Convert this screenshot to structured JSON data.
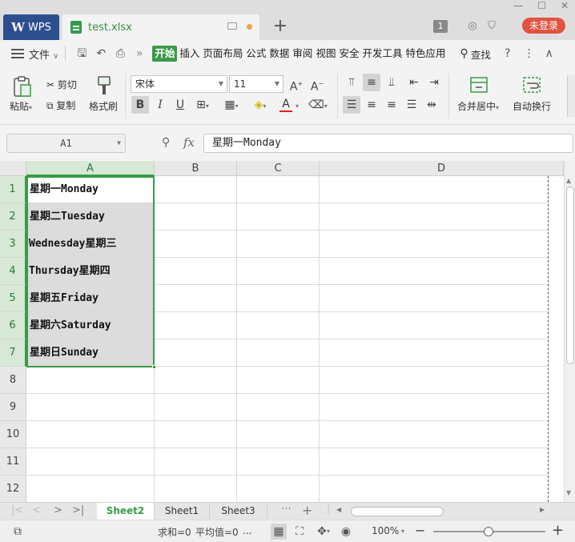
{
  "titlebar": {
    "app_tab": "WPS",
    "doc_tab": "test.xlsx",
    "tab_count": "1",
    "login": "未登录"
  },
  "menubar": {
    "file": "文件",
    "tabs": [
      {
        "label": "开始",
        "active": true
      },
      {
        "label": "插入"
      },
      {
        "label": "页面布局"
      },
      {
        "label": "公式"
      },
      {
        "label": "数据"
      },
      {
        "label": "审阅"
      },
      {
        "label": "视图"
      },
      {
        "label": "安全"
      },
      {
        "label": "开发工具"
      },
      {
        "label": "特色应用"
      }
    ],
    "search": "查找"
  },
  "ribbon": {
    "paste": "粘贴",
    "cut": "剪切",
    "copy": "复制",
    "format_painter": "格式刷",
    "font_name": "宋体",
    "font_size": "11",
    "merge_center": "合并居中",
    "wrap_text": "自动换行"
  },
  "formula": {
    "cell_ref": "A1",
    "fx": "fx",
    "value": "星期一Monday"
  },
  "grid": {
    "columns": [
      "A",
      "B",
      "C",
      "D"
    ],
    "rows": [
      "1",
      "2",
      "3",
      "4",
      "5",
      "6",
      "7",
      "8",
      "9",
      "10",
      "11",
      "12"
    ],
    "cells_A": [
      "星期一Monday",
      "星期二Tuesday",
      "Wednesday星期三",
      "Thursday星期四",
      "星期五Friday",
      "星期六Saturday",
      "星期日Sunday"
    ]
  },
  "sheets": [
    {
      "label": "Sheet2",
      "active": true
    },
    {
      "label": "Sheet1"
    },
    {
      "label": "Sheet3"
    }
  ],
  "status": {
    "sum": "求和=0",
    "avg": "平均值=0",
    "more": "...",
    "zoom": "100%"
  },
  "colors": {
    "accent": "#3a9a48",
    "wps_tab": "#2d4f8f",
    "login": "#e25240"
  }
}
